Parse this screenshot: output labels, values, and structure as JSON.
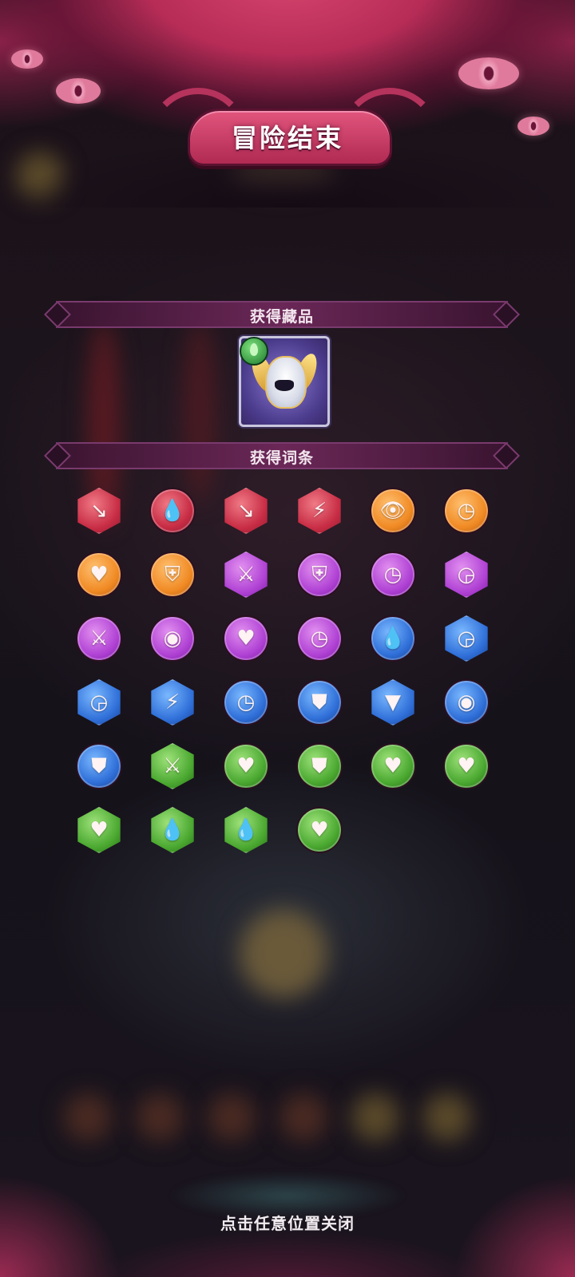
{
  "header": {
    "title": "冒险结束"
  },
  "sections": {
    "collection": {
      "label": "获得藏品"
    },
    "traits": {
      "label": "获得词条"
    }
  },
  "collection_item": {
    "icon": "winged-helmet-icon",
    "rarity_badge": "green-gem-badge"
  },
  "trait_icons": [
    {
      "name": "arrow-down-strike-icon",
      "color": "red",
      "shape": "hex",
      "glyph": "↘"
    },
    {
      "name": "blood-drop-down-icon",
      "color": "red",
      "shape": "circle",
      "glyph": "💧"
    },
    {
      "name": "arrow-down-strike-icon",
      "color": "red",
      "shape": "hex",
      "glyph": "↘"
    },
    {
      "name": "broken-shield-icon",
      "color": "red",
      "shape": "hex",
      "glyph": "⚡"
    },
    {
      "name": "eye-cycle-icon",
      "color": "orange",
      "shape": "circle",
      "glyph": "👁"
    },
    {
      "name": "clock-down-icon",
      "color": "orange",
      "shape": "circle",
      "glyph": "◷"
    },
    {
      "name": "figure-heart-icon",
      "color": "orange",
      "shape": "circle",
      "glyph": "♥"
    },
    {
      "name": "shield-icon",
      "color": "orange",
      "shape": "circle",
      "glyph": "⛨"
    },
    {
      "name": "figure-sword-icon",
      "color": "purple",
      "shape": "hex",
      "glyph": "⚔"
    },
    {
      "name": "shield-icon",
      "color": "purple",
      "shape": "circle",
      "glyph": "⛨"
    },
    {
      "name": "clock-down-icon",
      "color": "purple",
      "shape": "circle",
      "glyph": "◷"
    },
    {
      "name": "clock-up-icon",
      "color": "purple",
      "shape": "hex",
      "glyph": "◶"
    },
    {
      "name": "crossed-swords-icon",
      "color": "purple",
      "shape": "circle",
      "glyph": "⚔"
    },
    {
      "name": "figure-aura-icon",
      "color": "purple",
      "shape": "circle",
      "glyph": "◉"
    },
    {
      "name": "figure-heart-icon",
      "color": "purple",
      "shape": "circle",
      "glyph": "♥"
    },
    {
      "name": "clock-down-icon",
      "color": "purple",
      "shape": "circle",
      "glyph": "◷"
    },
    {
      "name": "water-drop-down-icon",
      "color": "blue",
      "shape": "circle",
      "glyph": "💧"
    },
    {
      "name": "clock-up-icon",
      "color": "blue",
      "shape": "hex",
      "glyph": "◶"
    },
    {
      "name": "clock-up-icon",
      "color": "blue",
      "shape": "hex",
      "glyph": "◶"
    },
    {
      "name": "broken-shield-icon",
      "color": "blue",
      "shape": "hex",
      "glyph": "⚡"
    },
    {
      "name": "clock-down-icon",
      "color": "blue",
      "shape": "circle",
      "glyph": "◷"
    },
    {
      "name": "figure-shield-icon",
      "color": "blue",
      "shape": "circle",
      "glyph": "⛊"
    },
    {
      "name": "fangs-icon",
      "color": "blue",
      "shape": "hex",
      "glyph": "▼"
    },
    {
      "name": "figure-aura-icon",
      "color": "blue",
      "shape": "circle",
      "glyph": "◉"
    },
    {
      "name": "figure-shield-icon",
      "color": "blue",
      "shape": "circle",
      "glyph": "⛊"
    },
    {
      "name": "figure-sword-icon",
      "color": "green",
      "shape": "hex",
      "glyph": "⚔"
    },
    {
      "name": "heart-plus-icon",
      "color": "green",
      "shape": "circle",
      "glyph": "♥"
    },
    {
      "name": "figure-shield-icon",
      "color": "green",
      "shape": "circle",
      "glyph": "⛊"
    },
    {
      "name": "heart-plus-icon",
      "color": "green",
      "shape": "circle",
      "glyph": "♥"
    },
    {
      "name": "heart-plus-icon",
      "color": "green",
      "shape": "circle",
      "glyph": "♥"
    },
    {
      "name": "dripping-heart-icon",
      "color": "green",
      "shape": "hex",
      "glyph": "♥"
    },
    {
      "name": "drops-up-icon",
      "color": "green",
      "shape": "hex",
      "glyph": "💧"
    },
    {
      "name": "drops-up-icon",
      "color": "green",
      "shape": "hex",
      "glyph": "💧"
    },
    {
      "name": "figure-heart-icon",
      "color": "green",
      "shape": "circle",
      "glyph": "♥"
    }
  ],
  "footer": {
    "close_hint": "点击任意位置关闭"
  }
}
